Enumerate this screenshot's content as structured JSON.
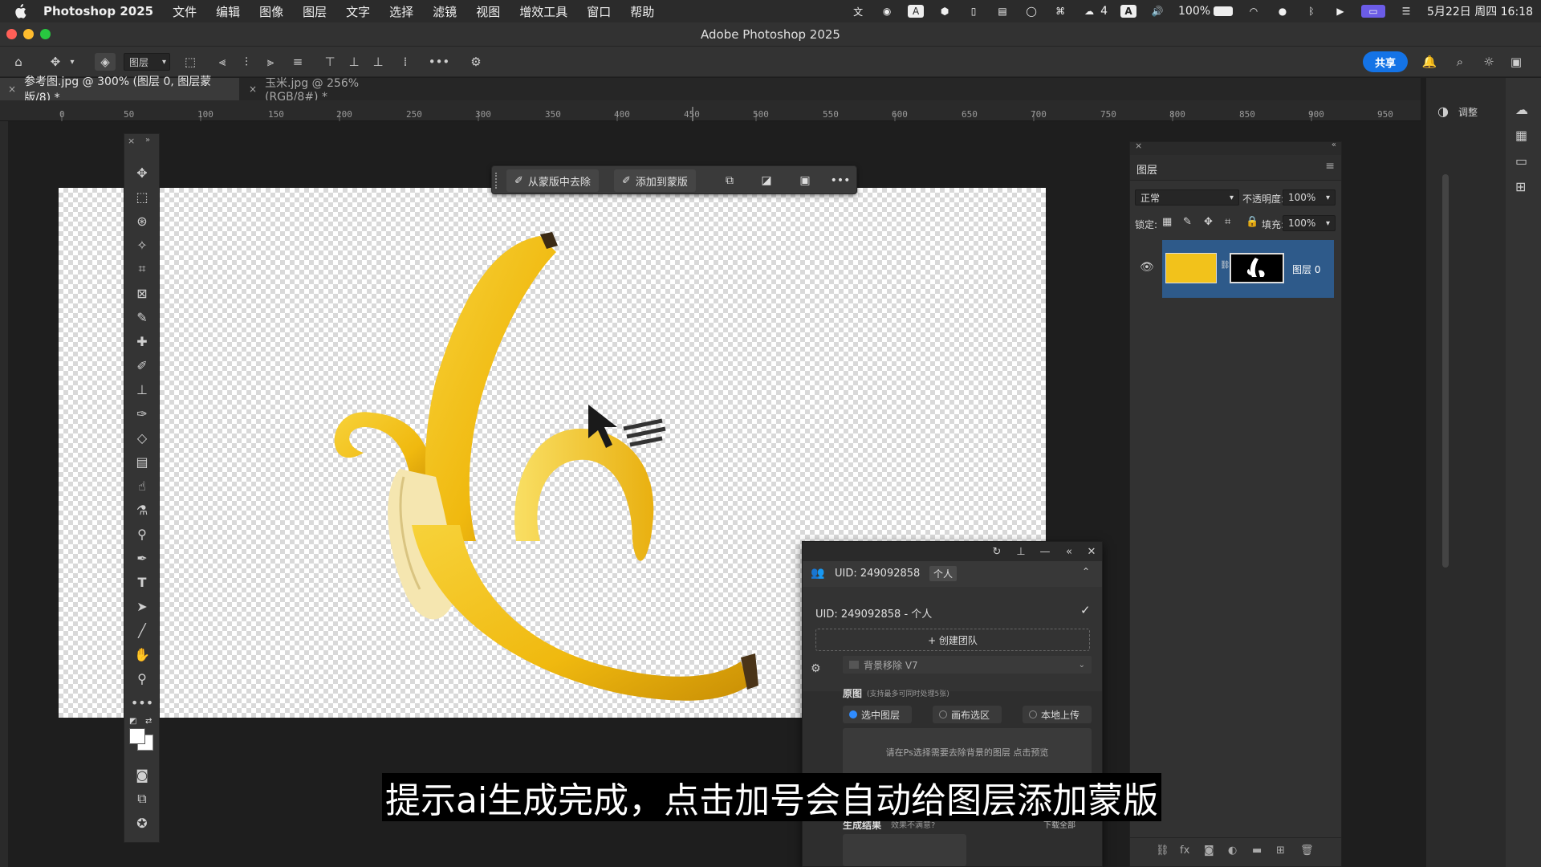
{
  "menubar": {
    "app_name": "Photoshop 2025",
    "items": [
      "文件",
      "编辑",
      "图像",
      "图层",
      "文字",
      "选择",
      "滤镜",
      "视图",
      "增效工具",
      "窗口",
      "帮助"
    ],
    "status": {
      "wechat_count": "4",
      "input_method": "A",
      "battery": "100%",
      "datetime": "5月22日 周四  16:18"
    }
  },
  "window": {
    "title": "Adobe Photoshop 2025"
  },
  "optionsbar": {
    "layer_select": "图层",
    "share_label": "共享"
  },
  "tabs": [
    {
      "label": "参考图.jpg @ 300% (图层 0, 图层蒙版/8) *"
    },
    {
      "label": "玉米.jpg @ 256%(RGB/8#) *"
    }
  ],
  "ruler": {
    "labels": [
      "0",
      "50",
      "100",
      "150",
      "200",
      "250",
      "300",
      "350",
      "400",
      "450",
      "500",
      "550",
      "600",
      "650",
      "700",
      "750",
      "800",
      "850",
      "900",
      "950"
    ]
  },
  "context_bar": {
    "subtract_label": "从蒙版中去除",
    "add_label": "添加到蒙版"
  },
  "layers_panel": {
    "title": "图层",
    "blend_mode": "正常",
    "opacity_label": "不透明度:",
    "opacity_value": "100%",
    "lock_label": "锁定:",
    "fill_label": "填充:",
    "fill_value": "100%",
    "layer_name": "图层 0"
  },
  "right_panel": {
    "adjust_label": "调整"
  },
  "plugin": {
    "uid_header": "UID: 249092858",
    "uid_badge": "个人",
    "uid_line": "UID: 249092858 - 个人",
    "create_team": "+ 创建团队",
    "feature": "背景移除 V7",
    "source_label": "原图",
    "source_note": "(支持最多可同时处理5张)",
    "options": [
      "选中图层",
      "画布选区",
      "本地上传"
    ],
    "hint": "请在Ps选择需要去除背景的图层 点击预览",
    "result_label": "生成结果",
    "result_note": "效果不满意?",
    "download_label": "下载全部"
  },
  "subtitle": "提示ai生成完成，点击加号会自动给图层添加蒙版",
  "colors": {
    "accent": "#1473e6",
    "selected_layer": "#2e5a8a",
    "banana": "#f2c21b"
  }
}
